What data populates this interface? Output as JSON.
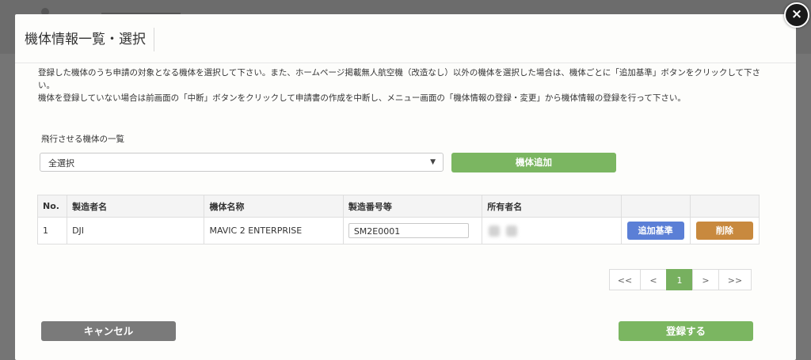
{
  "modal": {
    "title": "機体情報一覧・選択",
    "close_symbol": "×",
    "description": [
      "登録した機体のうち申請の対象となる機体を選択して下さい。また、ホームページ掲載無人航空機（改造なし）以外の機体を選択した場合は、機体ごとに「追加基準」ボタンをクリックして下さい。",
      "機体を登録していない場合は前画面の「中断」ボタンをクリックして申請書の作成を中断し、メニュー画面の「機体情報の登録・変更」から機体情報の登録を行って下さい。"
    ]
  },
  "select": {
    "label": "飛行させる機体の一覧",
    "value": "全選択",
    "caret": "▼"
  },
  "add_machine_label": "機体追加",
  "table": {
    "headers": [
      "No.",
      "製造者名",
      "機体名称",
      "製造番号等",
      "所有者名",
      "",
      ""
    ],
    "rows": [
      {
        "no": "1",
        "maker": "DJI",
        "model": "MAVIC 2 ENTERPRISE",
        "serial": "SM2E0001",
        "kijun_label": "追加基準",
        "delete_label": "削除"
      }
    ]
  },
  "pagination": {
    "first": "<<",
    "prev": "<",
    "current": "1",
    "next": ">",
    "last": ">>"
  },
  "footer": {
    "cancel_label": "キャンセル",
    "register_label": "登録する"
  },
  "colors": {
    "accent_green": "#7bb661",
    "blue_button": "#5b7fd6",
    "delete_button": "#c8893e",
    "cancel_gray": "#7a7a7a"
  }
}
